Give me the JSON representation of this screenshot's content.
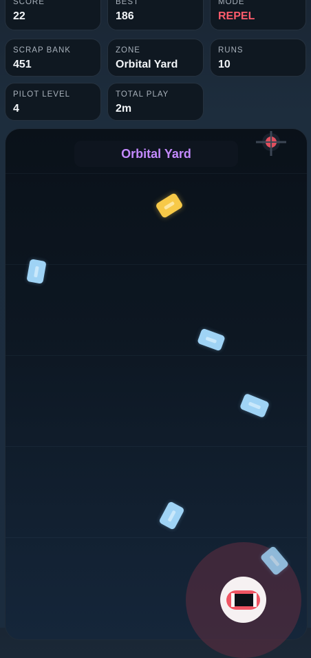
{
  "stats_row1": [
    {
      "label": "SCORE",
      "value": "22"
    },
    {
      "label": "BEST",
      "value": "186"
    },
    {
      "label": "MODE",
      "value": "REPEL"
    }
  ],
  "stats_row2": [
    {
      "label": "SCRAP BANK",
      "value": "451"
    },
    {
      "label": "ZONE",
      "value": "Orbital Yard"
    },
    {
      "label": "RUNS",
      "value": "10"
    }
  ],
  "stats_row3": [
    {
      "label": "PILOT LEVEL",
      "value": "4"
    },
    {
      "label": "TOTAL PLAY",
      "value": "2m"
    }
  ],
  "field": {
    "zone_title": "Orbital Yard"
  },
  "colors": {
    "mode_accent": "#ff5c6c",
    "zone_title": "#c48aff",
    "scrap_common": "#9fd3f5",
    "scrap_rare": "#f7c948",
    "magnet_field": "#622e40"
  },
  "icons": {
    "status_bar": [
      "whatsapp-icon",
      "app-icon",
      "lte-icon",
      "wifi-icon",
      "signal-icon",
      "battery-icon"
    ],
    "hazard": "mine-crosshair-icon",
    "player": "magnet-ship-icon"
  }
}
